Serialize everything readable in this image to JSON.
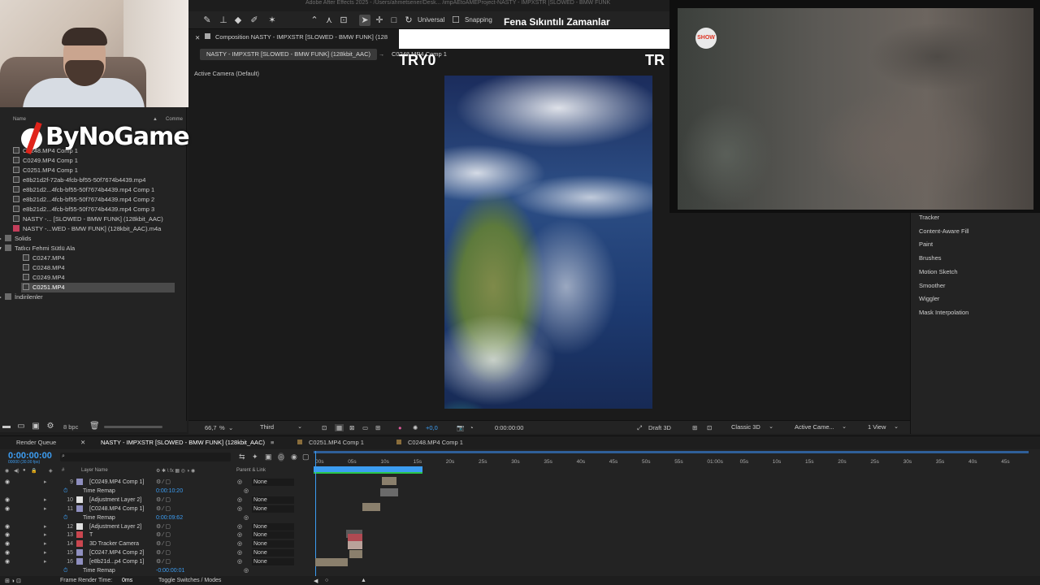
{
  "app_title": "Adobe After Effects 2025 - /Users/ahmetsener/Desk... /impAEtoAMEProject-NASTY - IMPXSTR [SLOWED - BMW FUNK",
  "overlay_title": "Fena Sıkıntılı Zamanlar",
  "logo_text": "ByNoGame",
  "toolbar": {
    "universal_label": "Universal",
    "snapping_label": "Snapping"
  },
  "project": {
    "col_name": "Name",
    "col_comment": "Comme",
    "items": [
      {
        "label": "C0248.MP4 Comp 1",
        "type": "comp"
      },
      {
        "label": "C0249.MP4 Comp 1",
        "type": "comp"
      },
      {
        "label": "C0251.MP4 Comp 1",
        "type": "comp"
      },
      {
        "label": "e8b21d2f-72ab-4fcb-bf55-50f7674b4439.mp4",
        "type": "file"
      },
      {
        "label": "e8b21d2...4fcb-bf55-50f7674b4439.mp4 Comp 1",
        "type": "comp"
      },
      {
        "label": "e8b21d2...4fcb-bf55-50f7674b4439.mp4 Comp 2",
        "type": "comp"
      },
      {
        "label": "e8b21d2...4fcb-bf55-50f7674b4439.mp4 Comp 3",
        "type": "comp"
      },
      {
        "label": "NASTY -... [SLOWED - BMW FUNK] (128kbit_AAC)",
        "type": "comp"
      },
      {
        "label": "NASTY -...WED - BMW FUNK] (128kbit_AAC).m4a",
        "type": "audio"
      },
      {
        "label": "Solids",
        "type": "folder"
      },
      {
        "label": "Tatlıcı Fehmi Sütlü Ala",
        "type": "folder"
      },
      {
        "label": "C0247.MP4",
        "type": "file"
      },
      {
        "label": "C0248.MP4",
        "type": "file"
      },
      {
        "label": "C0249.MP4",
        "type": "file"
      },
      {
        "label": "C0251.MP4",
        "type": "file"
      },
      {
        "label": "İndirilenler",
        "type": "folder"
      }
    ],
    "bpc": "8 bpc"
  },
  "composition": {
    "tab_title": "Composition NASTY - IMPXSTR [SLOWED - BMW FUNK] (128",
    "subtabs": [
      "NASTY - IMPXSTR [SLOWED - BMW FUNK] (128kbit_AAC)",
      "C0248.MP4 Comp 1"
    ],
    "camera_label": "Active Camera (Default)",
    "overlay_text_left": "TRY0",
    "overlay_text_right": "TR",
    "footer": {
      "zoom": "66,7",
      "zoom_unit": "%",
      "resolution": "Third",
      "exposure": "+0,0",
      "timecode": "0:00:00:00",
      "draft": "Draft 3D",
      "renderer": "Classic 3D",
      "camera": "Active Came...",
      "view": "1 View"
    }
  },
  "show_logo": "SHOW",
  "right_panel": {
    "items": [
      "Tracker",
      "Content-Aware Fill",
      "Paint",
      "Brushes",
      "Motion Sketch",
      "Smoother",
      "Wiggler",
      "Mask Interpolation"
    ]
  },
  "timeline": {
    "tabs": [
      "Render Queue",
      "NASTY - IMPXSTR [SLOWED - BMW FUNK] (128kbit_AAC)",
      "C0251.MP4 Comp 1",
      "C0248.MP4 Comp 1"
    ],
    "timecode": "0:00:00:00",
    "fps": "00000 (30.00 fps)",
    "col_hash": "#",
    "col_layer_name": "Layer Name",
    "col_parent": "Parent & Link",
    "ruler": [
      "00s",
      "05s",
      "10s",
      "15s",
      "20s",
      "25s",
      "30s",
      "35s",
      "40s",
      "45s",
      "50s",
      "55s",
      "01:00s",
      "05s",
      "10s",
      "15s",
      "20s",
      "25s",
      "30s",
      "35s",
      "40s",
      "45s"
    ],
    "layers": [
      {
        "num": "9",
        "name": "[C0249.MP4 Comp 1]",
        "label_color": "#8f8fbf",
        "parent": "None",
        "sub": false,
        "value": ""
      },
      {
        "num": "",
        "name": "Time Remap",
        "label_color": "",
        "parent": "",
        "sub": true,
        "value": "0:00:10:20"
      },
      {
        "num": "10",
        "name": "[Adjustment Layer 2]",
        "label_color": "#e0e0e0",
        "parent": "None",
        "sub": false,
        "value": ""
      },
      {
        "num": "11",
        "name": "[C0248.MP4 Comp 1]",
        "label_color": "#8f8fbf",
        "parent": "None",
        "sub": false,
        "value": ""
      },
      {
        "num": "",
        "name": "Time Remap",
        "label_color": "",
        "parent": "",
        "sub": true,
        "value": "0:00:09:62"
      },
      {
        "num": "12",
        "name": "[Adjustment Layer 2]",
        "label_color": "#e0e0e0",
        "parent": "None",
        "sub": false,
        "value": ""
      },
      {
        "num": "13",
        "name": "T",
        "label_color": "#c9464f",
        "parent": "None",
        "sub": false,
        "value": ""
      },
      {
        "num": "14",
        "name": "3D Tracker Camera",
        "label_color": "#c9464f",
        "parent": "None",
        "sub": false,
        "value": ""
      },
      {
        "num": "15",
        "name": "[C0247.MP4 Comp 2]",
        "label_color": "#8f8fbf",
        "parent": "None",
        "sub": false,
        "value": ""
      },
      {
        "num": "16",
        "name": "[e8b21d...p4 Comp 1]",
        "label_color": "#8f8fbf",
        "parent": "None",
        "sub": false,
        "value": ""
      },
      {
        "num": "",
        "name": "Time Remap",
        "label_color": "",
        "parent": "",
        "sub": true,
        "value": "-0:00:00:01"
      }
    ],
    "footer_render_label": "Frame Render Time:",
    "footer_render_value": "0ms",
    "footer_toggle": "Toggle Switches / Modes"
  }
}
